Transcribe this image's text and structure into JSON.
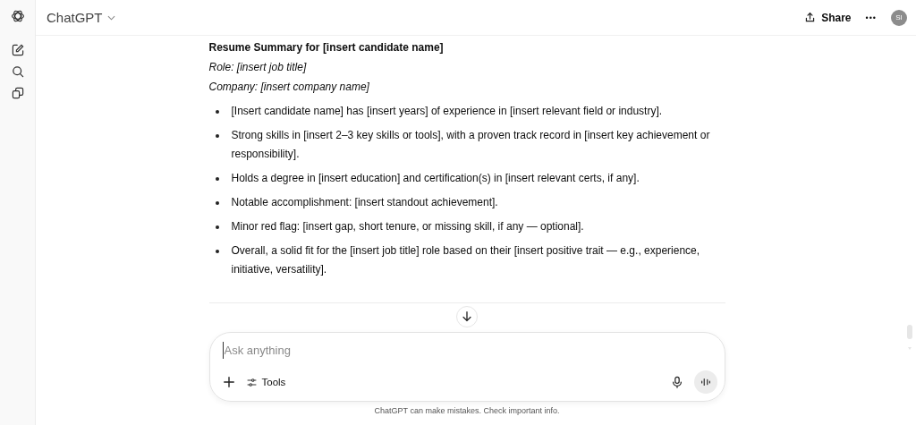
{
  "header": {
    "title": "ChatGPT",
    "share": "Share",
    "menu": "•••",
    "avatar": "SI"
  },
  "message": {
    "heading": "Resume Summary for [insert candidate name]",
    "role": "Role: [insert job title]",
    "company": "Company: [insert company name]",
    "bullets": [
      "[Insert candidate name] has [insert years] of experience in [insert relevant field or industry].",
      "Strong skills in [insert 2–3 key skills or tools], with a proven track record in [insert key achievement or responsibility].",
      "Holds a degree in [insert education] and certification(s) in [insert relevant certs, if any].",
      "Notable accomplishment: [insert standout achievement].",
      "Minor red flag: [insert gap, short tenure, or missing skill, if any — optional].",
      "Overall, a solid fit for the [insert job title] role based on their [insert positive trait — e.g., experience, initiative, versatility]."
    ]
  },
  "composer": {
    "placeholder": "Ask anything",
    "tools": "Tools"
  },
  "footer": "ChatGPT can make mistakes. Check important info."
}
